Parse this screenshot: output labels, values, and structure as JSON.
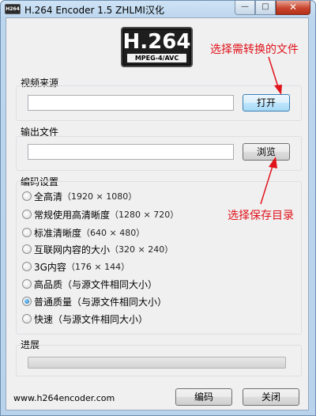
{
  "window": {
    "title": "H.264 Encoder 1.5   ZHLMI汉化",
    "app_icon_text": "H264",
    "min_glyph": "—",
    "max_glyph": "□",
    "close_glyph": "✕"
  },
  "logo": {
    "main": "H.264",
    "sub": "MPEG-4/AVC"
  },
  "source_group": {
    "label": "视频来源",
    "input_value": "",
    "open_button": "打开"
  },
  "output_group": {
    "label": "输出文件",
    "input_value": "",
    "browse_button": "浏览"
  },
  "encoding_group": {
    "label": "编码设置",
    "options": [
      {
        "label": "全高清",
        "detail": "（1920 × 1080）",
        "selected": false
      },
      {
        "label": "常规使用高清晰度",
        "detail": "（1280 × 720）",
        "selected": false
      },
      {
        "label": "标准清晰度",
        "detail": "（640 × 480）",
        "selected": false
      },
      {
        "label": "互联网内容的大小",
        "detail": "（320 × 240）",
        "selected": false
      },
      {
        "label": "3G内容",
        "detail": "（176 × 144）",
        "selected": false
      },
      {
        "label": "高品质（与源文件相同大小）",
        "detail": "",
        "selected": false
      },
      {
        "label": "普通质量（与源文件相同大小）",
        "detail": "",
        "selected": true
      },
      {
        "label": "快速（与源文件相同大小）",
        "detail": "",
        "selected": false
      }
    ]
  },
  "progress_group": {
    "label": "进展",
    "value": 0
  },
  "footer": {
    "link": "www.h264encoder.com",
    "encode_button": "编码",
    "close_button": "关闭"
  },
  "annotations": {
    "select_file": "选择需转换的文件",
    "select_dir": "选择保存目录",
    "color": "#e0131b"
  }
}
